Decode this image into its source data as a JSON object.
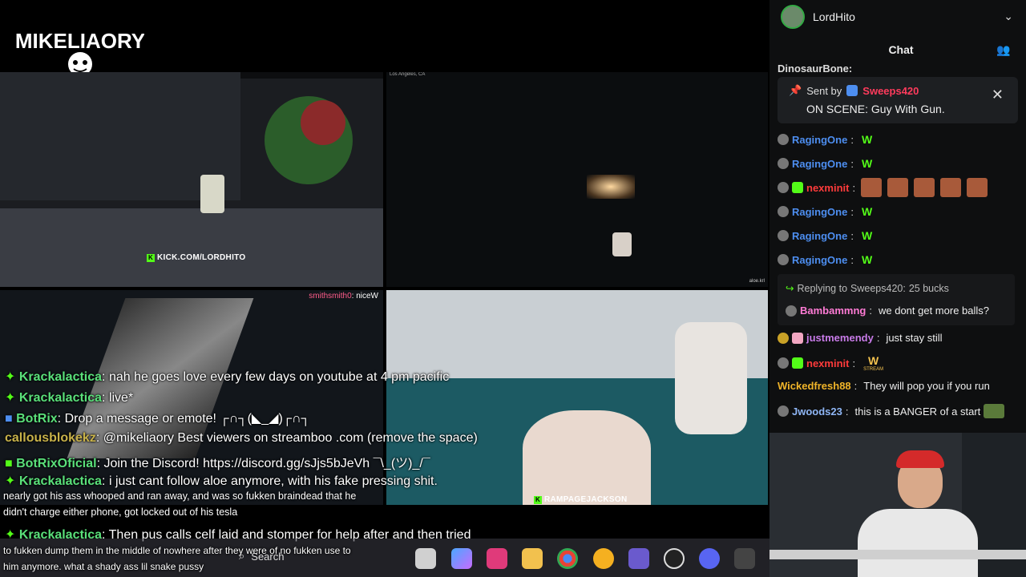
{
  "logo": {
    "text": "MIKELIAORY"
  },
  "videos": {
    "v1": {
      "tag": "KICK.COM/LORDHITO"
    },
    "v2": {
      "location": "Los Angeles, CA",
      "tag_right": "aloe.krl"
    },
    "v3": {
      "chat_user": "smithsmith0",
      "chat_text": "niceW"
    },
    "v4": {
      "tag": "RAMPAGEJACKSON"
    }
  },
  "overlay_chat": [
    {
      "user": "Krackalactica",
      "text": ": nah he goes love every few days on youtube at 4 pm pacific"
    },
    {
      "user": "Krackalactica",
      "text": ": live*"
    },
    {
      "user": "BotRix",
      "text": ": Drop a message or emote! ┌∩┐(◣_◢)┌∩┐"
    },
    {
      "user": "callousblokekz",
      "text": ": @mikeliaory Best viewers on streamboo .com (remove the space)"
    },
    {
      "user": "BotRixOficial",
      "text": ": Join the Discord! https://discord.gg/sJjs5bJeVh ¯\\_(ツ)_/¯"
    },
    {
      "user": "Krackalactica",
      "text": ": i just cant follow aloe anymore, with his fake pressing shit."
    }
  ],
  "overlay_plain": [
    "nearly got his ass whooped and ran away, and was so fukken braindead that he",
    "didn't charge either phone, got locked out of his tesla"
  ],
  "overlay_last": {
    "user": "Krackalactica",
    "text": ": Then pus calls celf laid and stomper for help after and then tried"
  },
  "overlay_tail": [
    "to fukken dump them in the middle of nowhere after they were of no fukken use to",
    "him anymore. what a shady ass lil snake pussy"
  ],
  "taskbar": {
    "search_label": "Search"
  },
  "chat_panel": {
    "username": "LordHito",
    "title": "Chat",
    "top_cut_user": "DinosaurBone:",
    "pinned": {
      "sent_by_label": "Sent by",
      "sender": "Sweeps420",
      "message": "ON SCENE: Guy With Gun."
    },
    "messages": [
      {
        "user": "RagingOne",
        "color": "#4d8ef0",
        "text": "W"
      },
      {
        "user": "RagingOne",
        "color": "#4d8ef0",
        "text": "W"
      },
      {
        "user": "nexminit",
        "color": "#ff3b3b",
        "text": ""
      },
      {
        "user": "RagingOne",
        "color": "#4d8ef0",
        "text": "W"
      },
      {
        "user": "RagingOne",
        "color": "#4d8ef0",
        "text": "W"
      },
      {
        "user": "RagingOne",
        "color": "#4d8ef0",
        "text": "W"
      }
    ],
    "reply": {
      "label": "Replying to",
      "target": "Sweeps420:",
      "target_text": "25 bucks",
      "user": "Bambammng",
      "text": "we dont get more balls?"
    },
    "more": [
      {
        "user": "justmemendy",
        "color": "#c87be8",
        "text": "just stay still"
      },
      {
        "user": "nexminit",
        "color": "#ff3b3b",
        "text": ""
      },
      {
        "user": "Wickedfresh88",
        "color": "#f0b429",
        "text": "They will pop you if you run"
      },
      {
        "user": "Jwoods23",
        "color": "#8fb6f5",
        "text": "this is a BANGER of a start"
      }
    ],
    "stream_emote": "STREAM"
  },
  "colors": {
    "kick_green": "#53fc18",
    "chat_bg": "#0e0f10"
  }
}
